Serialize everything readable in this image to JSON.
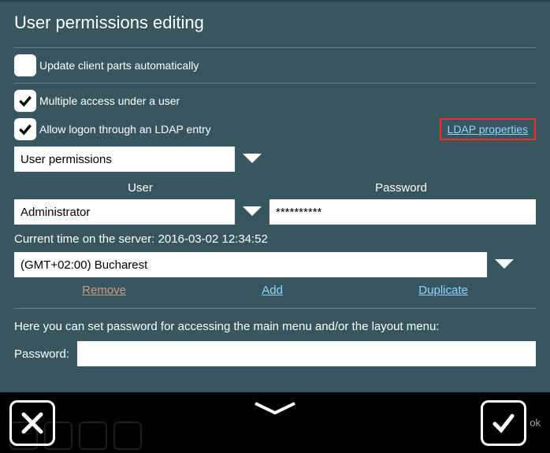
{
  "title": "User permissions editing",
  "checkboxes": {
    "update_auto": {
      "label": "Update client parts automatically",
      "checked": false
    },
    "multiple_access": {
      "label": "Multiple access under a user",
      "checked": true
    },
    "allow_ldap": {
      "label": "Allow logon through an LDAP entry",
      "checked": true
    }
  },
  "ldap_link": "LDAP properties",
  "permissions_dropdown": "User permissions",
  "headers": {
    "user": "User",
    "password": "Password"
  },
  "user_value": "Administrator",
  "password_value": "**********",
  "time_prefix": "Current time on the server: ",
  "time_value": "2016-03-02 12:34:52",
  "timezone": "(GMT+02:00) Bucharest",
  "actions": {
    "remove": "Remove",
    "add": "Add",
    "duplicate": "Duplicate"
  },
  "desc": "Here you can set password for accessing the main menu and/or the layout menu:",
  "pw_label": "Password:",
  "ok_label": "ok"
}
